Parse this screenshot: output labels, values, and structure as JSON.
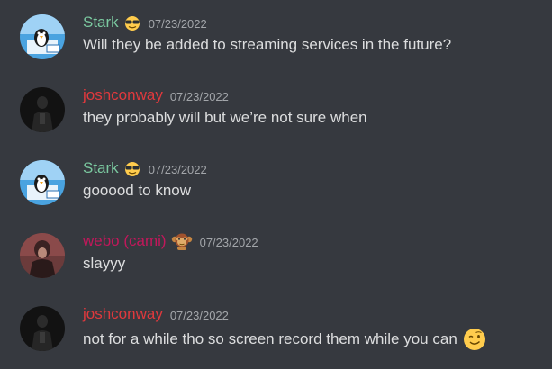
{
  "colors": {
    "background": "#36393f",
    "stark_name": "#7bc9a0",
    "joshconway_name": "#e0393d",
    "webo_name": "#c2185b",
    "message_text": "#dcddde",
    "timestamp": "#a3a6aa"
  },
  "messages": [
    {
      "username": "Stark",
      "username_color": "#7bc9a0",
      "badge_icon": "sunglasses-emoji-icon",
      "timestamp": "07/23/2022",
      "text": "Will they be added to streaming services in the future?",
      "avatar_icon": "penguin-avatar-icon"
    },
    {
      "username": "joshconway",
      "username_color": "#e0393d",
      "timestamp": "07/23/2022",
      "text": "they probably will but we’re not sure when",
      "avatar_icon": "dark-figure-avatar-icon"
    },
    {
      "username": "Stark",
      "username_color": "#7bc9a0",
      "badge_icon": "sunglasses-emoji-icon",
      "timestamp": "07/23/2022",
      "text": "gooood to know",
      "avatar_icon": "penguin-avatar-icon"
    },
    {
      "username": "webo (cami)",
      "username_color": "#c2185b",
      "badge_icon": "monkey-emoji-icon",
      "timestamp": "07/23/2022",
      "text": "slayyy",
      "avatar_icon": "photo-avatar-icon"
    },
    {
      "username": "joshconway",
      "username_color": "#e0393d",
      "timestamp": "07/23/2022",
      "text": "not for a while tho so screen record them while you can",
      "trailing_emoji_icon": "winking-face-emoji-icon",
      "avatar_icon": "dark-figure-avatar-icon"
    }
  ]
}
